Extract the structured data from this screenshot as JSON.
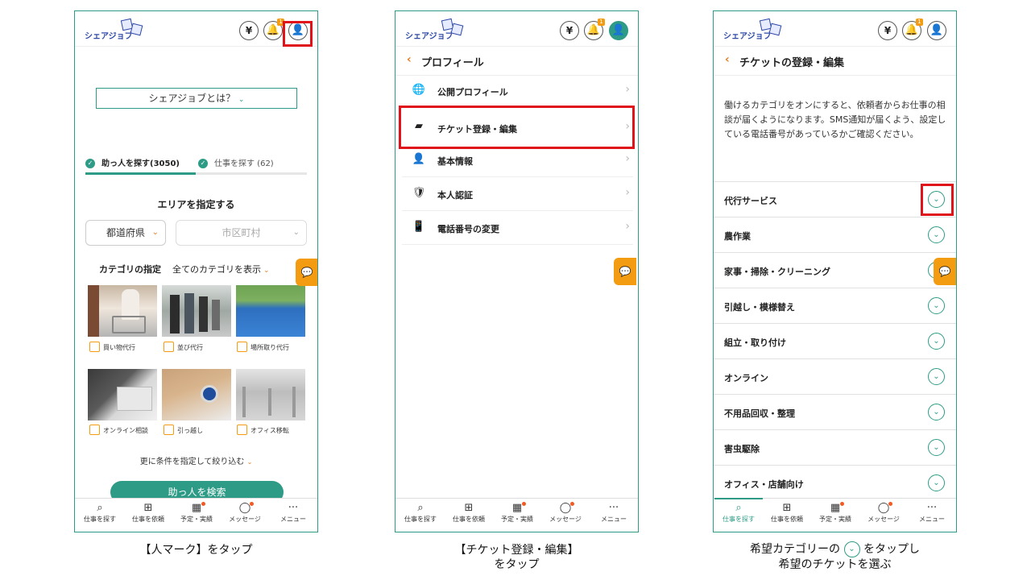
{
  "app": {
    "logo_text": "シェアジョブ"
  },
  "header": {
    "yen_icon": "¥",
    "notify_badge": "1"
  },
  "colors": {
    "accent": "#2e9b86",
    "orange": "#f39c12",
    "highlight": "#e0131b"
  },
  "panel1": {
    "what_is": "シェアジョブとは？",
    "tab_helper": "助っ人を探す(3050)",
    "tab_jobs": "仕事を探す (62)",
    "area_title": "エリアを指定する",
    "prefecture": "都道府県",
    "city": "市区町村",
    "category_label": "カテゴリの指定",
    "category_show_all": "全てのカテゴリを表示",
    "categories": [
      "買い物代行",
      "並び代行",
      "場所取り代行",
      "オンライン相談",
      "引っ越し",
      "オフィス移転"
    ],
    "more_conditions": "更に条件を指定して絞り込む",
    "search_button": "助っ人を検索"
  },
  "panel2": {
    "title": "プロフィール",
    "items": [
      "公開プロフィール",
      "チケット登録・編集",
      "基本情報",
      "本人認証",
      "電話番号の変更"
    ]
  },
  "panel3": {
    "title": "チケットの登録・編集",
    "description": "働けるカテゴリをオンにすると、依頼者からお仕事の相談が届くようになります。SMS通知が届くよう、設定している電話番号があっているかご確認ください。",
    "categories": [
      "代行サービス",
      "農作業",
      "家事・掃除・クリーニング",
      "引越し・模様替え",
      "組立・取り付け",
      "オンライン",
      "不用品回収・整理",
      "害虫駆除",
      "オフィス・店舗向け"
    ]
  },
  "bottom_nav": [
    "仕事を探す",
    "仕事を依頼",
    "予定・実績",
    "メッセージ",
    "メニュー"
  ],
  "captions": {
    "c1": "【人マーク】をタップ",
    "c2_line1": "【チケット登録・編集】",
    "c2_line2": "をタップ",
    "c3_line1_a": "希望カテゴリーの",
    "c3_line1_b": "をタップし",
    "c3_line2": "希望のチケットを選ぶ"
  }
}
